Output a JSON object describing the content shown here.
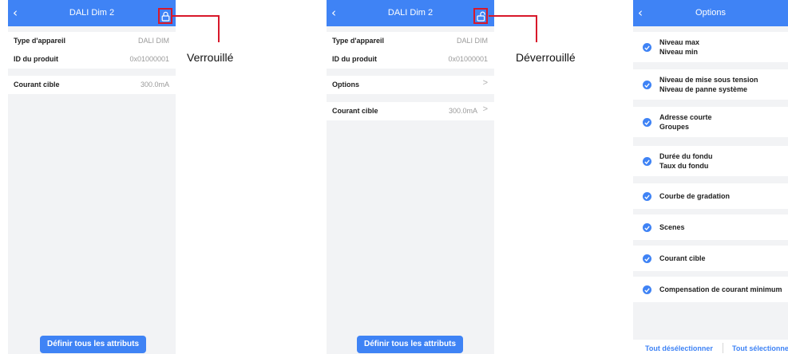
{
  "screen1": {
    "title": "DALI Dim 2",
    "back_icon": "chevron-left-icon",
    "lock_icon": "lock-closed-icon",
    "rows": [
      {
        "label": "Type d'appareil",
        "value": "DALI DIM"
      },
      {
        "label": "ID du produit",
        "value": "0x01000001"
      },
      {
        "label": "Courant cible",
        "value": "300.0mA"
      }
    ],
    "button": "Définir tous les attributs",
    "callout": "Verrouillé"
  },
  "screen2": {
    "title": "DALI Dim 2",
    "back_icon": "chevron-left-icon",
    "lock_icon": "lock-open-icon",
    "rows": [
      {
        "label": "Type d'appareil",
        "value": "DALI DIM"
      },
      {
        "label": "ID du produit",
        "value": "0x01000001"
      },
      {
        "label": "Options",
        "value": ">"
      },
      {
        "label": "Courant cible",
        "value": "300.0mA"
      }
    ],
    "chevron": ">",
    "button": "Définir tous les attributs",
    "callout": "Déverrouillé"
  },
  "screen3": {
    "title": "Options",
    "back_icon": "chevron-left-icon",
    "options": [
      {
        "line1": "Niveau max",
        "line2": "Niveau min"
      },
      {
        "line1": "Niveau de mise sous tension",
        "line2": "Niveau de panne système"
      },
      {
        "line1": "Adresse courte",
        "line2": "Groupes"
      },
      {
        "line1": "Durée du fondu",
        "line2": "Taux du fondu"
      },
      {
        "line1": "Courbe de gradation"
      },
      {
        "line1": "Scenes"
      },
      {
        "line1": "Courant cible"
      },
      {
        "line1": "Compensation de courant minimum"
      }
    ],
    "footer": {
      "deselect_all": "Tout désélectionner",
      "select_all": "Tout sélectionne"
    }
  },
  "colors": {
    "accent": "#3f83f5",
    "highlight": "#d8182a",
    "background": "#f2f3f5"
  }
}
